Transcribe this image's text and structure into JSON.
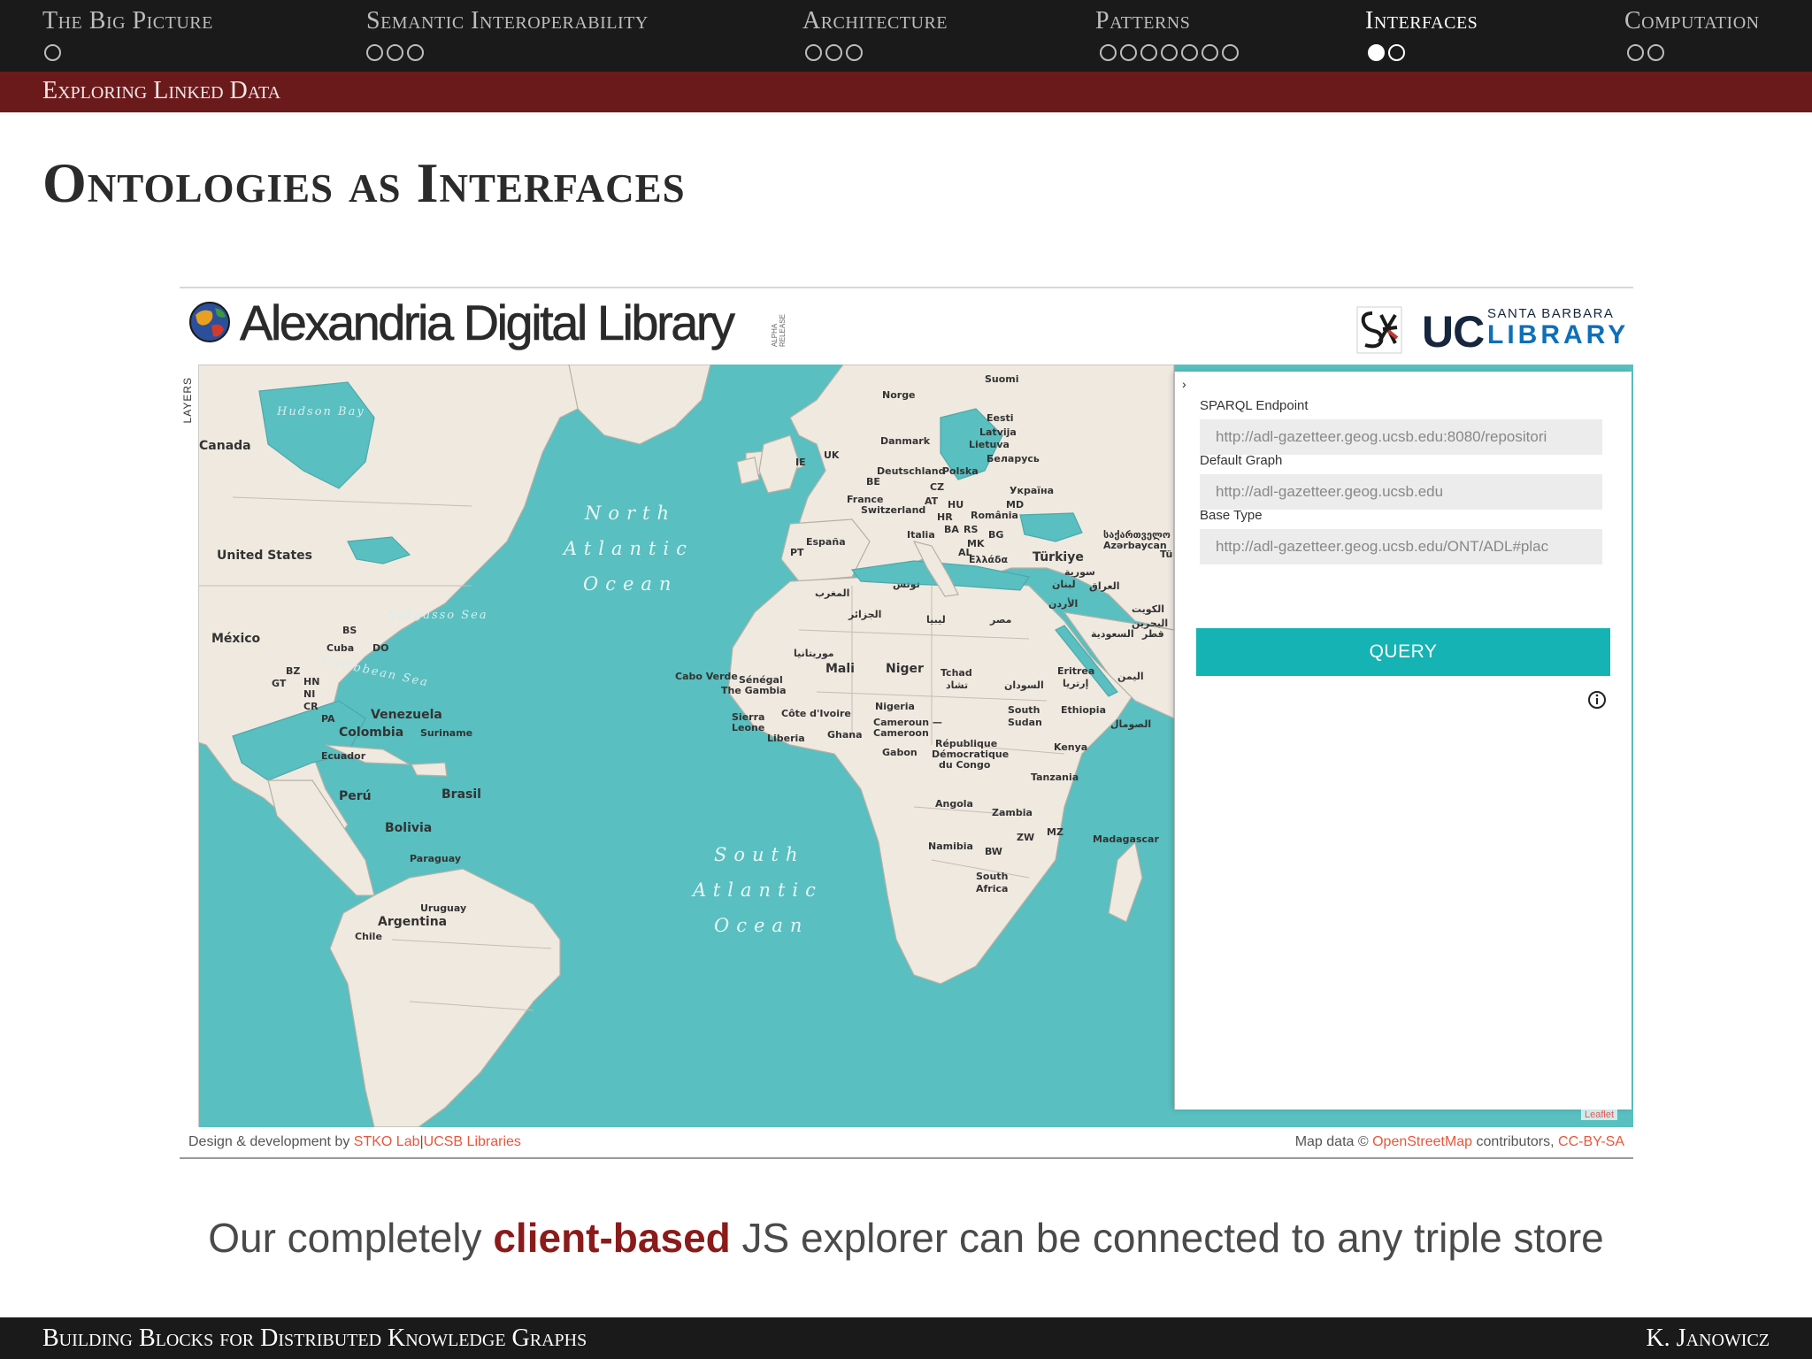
{
  "nav": {
    "sections": [
      {
        "label": "The Big Picture",
        "dots": 1,
        "filled": 0,
        "active": false
      },
      {
        "label": "Semantic Interoperability",
        "dots": 3,
        "filled": 0,
        "active": false
      },
      {
        "label": "Architecture",
        "dots": 3,
        "filled": 0,
        "active": false
      },
      {
        "label": "Patterns",
        "dots": 7,
        "filled": 0,
        "active": false
      },
      {
        "label": "Interfaces",
        "dots": 2,
        "filled": 1,
        "active": true
      },
      {
        "label": "Computation",
        "dots": 2,
        "filled": 0,
        "active": false
      }
    ]
  },
  "subsection": "Exploring Linked Data",
  "frame_title": "Ontologies as Interfaces",
  "app": {
    "title": "Alexandria Digital Library",
    "alpha_tag": "ALPHA RELEASE",
    "uc_logo": {
      "main": "UC",
      "line1": "SANTA BARBARA",
      "line2": "LIBRARY"
    },
    "layers_label": "LAYERS",
    "panel": {
      "toggle": "›",
      "sparql_label": "SPARQL Endpoint",
      "sparql_value": "http://adl-gazetteer.geog.ucsb.edu:8080/repositori",
      "graph_label": "Default Graph",
      "graph_value": "http://adl-gazetteer.geog.ucsb.edu",
      "type_label": "Base Type",
      "type_value": "http://adl-gazetteer.geog.ucsb.edu/ONT/ADL#plac",
      "query_button": "QUERY",
      "info_icon": "info-icon"
    },
    "leaflet": "Leaflet",
    "footer": {
      "design_prefix": "Design & development by",
      "stko": "STKO Lab",
      "separator": "|",
      "ucsb": "UCSB Libraries",
      "map_prefix": "Map data ©",
      "osm": "OpenStreetMap",
      "contrib": "contributors,",
      "license": "CC-BY-SA"
    },
    "map_labels": {
      "hudson_bay": "Hudson Bay",
      "canada": "Canada",
      "united_states": "United States",
      "mexico": "México",
      "cuba": "Cuba",
      "bs": "BS",
      "do": "DO",
      "bz": "BZ",
      "gt": "GT",
      "hn": "HN",
      "ni": "NI",
      "cr": "CR",
      "pa": "PA",
      "caribbean": "Caribbean Sea",
      "sargasso": "Sargasso Sea",
      "venezuela": "Venezuela",
      "colombia": "Colombia",
      "suriname": "Suriname",
      "ecuador": "Ecuador",
      "peru": "Perú",
      "brasil": "Brasil",
      "bolivia": "Bolivia",
      "paraguay": "Paraguay",
      "uruguay": "Uruguay",
      "argentina": "Argentina",
      "chile": "Chile",
      "north1": "North",
      "north2": "Atlantic",
      "north3": "Ocean",
      "south1": "South",
      "south2": "Atlantic",
      "south3": "Ocean",
      "suomi": "Suomi",
      "norge": "Norge",
      "eesti": "Eesti",
      "latvija": "Latvija",
      "lietuva": "Lietuva",
      "danmark": "Danmark",
      "uk": "UK",
      "ie": "IE",
      "belarus": "Беларусь",
      "deutschland": "Deutschland",
      "polska": "Polska",
      "be": "BE",
      "cz": "CZ",
      "ukraina": "Україна",
      "france": "France",
      "switzerland": "Switzerland",
      "at": "AT",
      "hu": "HU",
      "md": "MD",
      "hr": "HR",
      "romania": "România",
      "ba": "BA",
      "rs": "RS",
      "espana": "España",
      "pt": "PT",
      "italia": "Italia",
      "bg": "BG",
      "mk": "MK",
      "al": "AL",
      "ellada": "Ελλάδα",
      "turkiye": "Türkiye",
      "georgia": "საქართველო",
      "azerbaycan": "Azərbaycan",
      "suriya": "سورية",
      "iraq": "العراق",
      "tunis": "تونس",
      "lubnan": "لبنان",
      "urdun": "الأردن",
      "maghrib": "المغرب",
      "jazair": "الجزائر",
      "libya": "ليبيا",
      "misr": "مصر",
      "saudi": "السعودية",
      "bahrain": "البحرين",
      "qatar": "قطر",
      "kuwait": "الكويت",
      "mauritania": "موريتانيا",
      "mali": "Mali",
      "niger": "Niger",
      "tchad": "Tchad",
      "tchad_ar": "تشاد",
      "sudan_ar": "السودان",
      "eritrea": "Eritrea",
      "eritrea_ar": "إرتريا",
      "yemen": "اليمن",
      "cabo_verde": "Cabo Verde",
      "senegal": "Sénégal",
      "gambia": "The Gambia",
      "nigeria": "Nigeria",
      "south_sudan1": "South",
      "south_sudan2": "Sudan",
      "ethiopia": "Ethiopia",
      "somalia": "الصومال",
      "sierra": "Sierra",
      "leone": "Leone",
      "cote": "Côte d'Ivoire",
      "liberia": "Liberia",
      "ghana": "Ghana",
      "cameroun1": "Cameroun —",
      "cameroun2": "Cameroon",
      "gabon": "Gabon",
      "rdc1": "République",
      "rdc2": "Démocratique",
      "rdc3": "du Congo",
      "kenya": "Kenya",
      "tanzania": "Tanzania",
      "angola": "Angola",
      "zambia": "Zambia",
      "zw": "ZW",
      "mz": "MZ",
      "madagascar": "Madagascar",
      "namibia": "Namibia",
      "bw": "BW",
      "south_africa1": "South",
      "south_africa2": "Africa",
      "tu": "Tü"
    }
  },
  "caption": {
    "before": "Our completely",
    "highlight": "client-based",
    "after": "JS explorer can be connected to any triple store"
  },
  "footline": {
    "left": "Building Blocks for Distributed Knowledge Graphs",
    "right": "K. Janowicz"
  },
  "colors": {
    "header_bg": "#1a1a1a",
    "subsection_bg": "#6b1a1c",
    "ocean": "#59bfc0",
    "land": "#efe9e0",
    "query_button": "#15b3b3",
    "highlight": "#8b1a1a"
  }
}
